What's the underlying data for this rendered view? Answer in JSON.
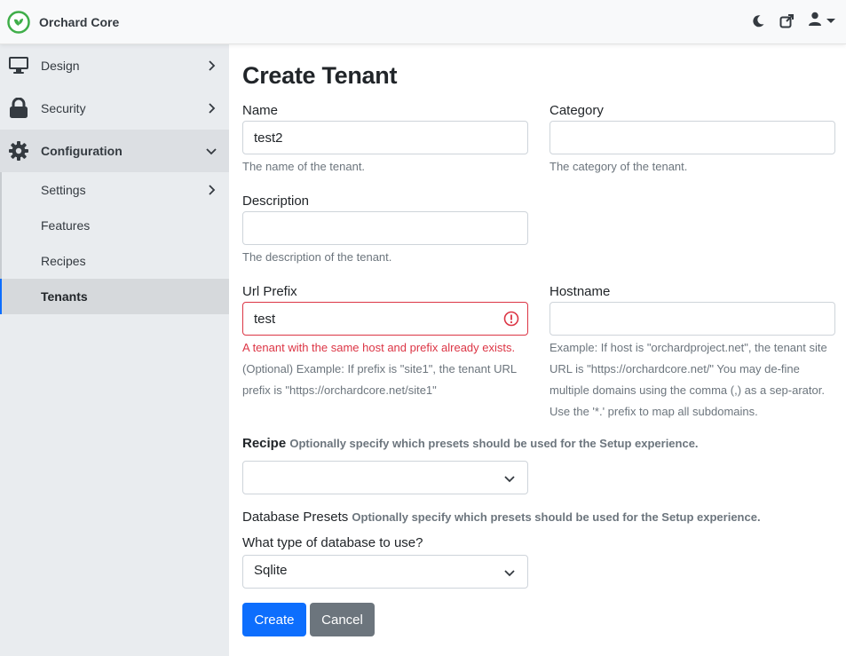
{
  "header": {
    "brand": "Orchard Core",
    "icons": [
      "moon-icon",
      "external-link-icon",
      "user-icon"
    ]
  },
  "sidebar": {
    "items": [
      {
        "label": "Design",
        "icon": "monitor-icon"
      },
      {
        "label": "Security",
        "icon": "lock-icon"
      },
      {
        "label": "Configuration",
        "icon": "gear-icon"
      }
    ],
    "subitems": [
      {
        "label": "Settings"
      },
      {
        "label": "Features"
      },
      {
        "label": "Recipes"
      },
      {
        "label": "Tenants"
      }
    ]
  },
  "form": {
    "title": "Create Tenant",
    "name": {
      "label": "Name",
      "value": "test2",
      "hint": "The name of the tenant."
    },
    "category": {
      "label": "Category",
      "value": "",
      "hint": "The category of the tenant."
    },
    "description": {
      "label": "Description",
      "value": "",
      "hint": "The description of the tenant."
    },
    "url_prefix": {
      "label": "Url Prefix",
      "value": "test",
      "error": "A tenant with the same host and prefix already exists.",
      "hint": " (Optional) Example: If prefix is \"site1\", the tenant URL prefix is \"https://orchardcore.net/site1\""
    },
    "hostname": {
      "label": "Hostname",
      "value": "",
      "hint": "Example: If host is \"orchardproject.net\", the tenant site URL is \"https://orchardcore.net/\" You may de-fine multiple domains using the comma (,) as a sep-arator. Use the '*.' prefix to map all subdomains."
    },
    "recipe": {
      "label": "Recipe",
      "note": "Optionally specify which presets should be used for the Setup experience.",
      "selected": ""
    },
    "database_presets": {
      "label": "Database Presets",
      "note": "Optionally specify which presets should be used for the Setup experience."
    },
    "database_type": {
      "label": "What type of database to use?",
      "selected": "Sqlite"
    },
    "create_label": "Create",
    "cancel_label": "Cancel"
  },
  "colors": {
    "primary": "#0d6efd",
    "secondary": "#6c757d",
    "danger": "#dc3545",
    "brand": "#4caf50"
  }
}
